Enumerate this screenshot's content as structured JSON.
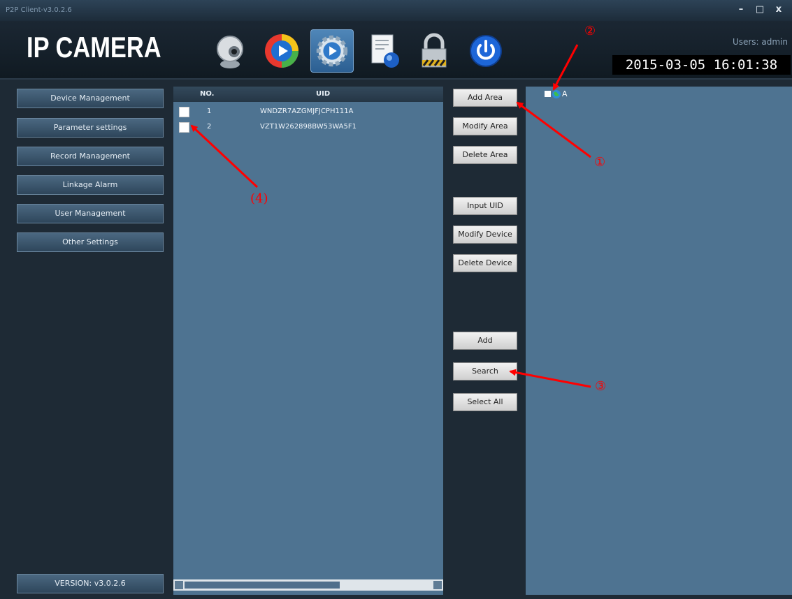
{
  "window": {
    "title": "P2P Client-v3.0.2.6",
    "controls": {
      "minimize": "–",
      "maximize": "□",
      "close": "x"
    }
  },
  "header": {
    "logo": "IP CAMERA",
    "toolbar_icons": [
      "webcam-icon",
      "playback-icon",
      "settings-icon",
      "document-icon",
      "lock-icon",
      "power-icon"
    ],
    "active_tool": "settings-icon",
    "users_label": "Users: admin",
    "datetime": "2015-03-05 16:01:38"
  },
  "sidebar": {
    "items": [
      {
        "label": "Device Management"
      },
      {
        "label": "Parameter settings"
      },
      {
        "label": "Record Management"
      },
      {
        "label": "Linkage Alarm"
      },
      {
        "label": "User Management"
      },
      {
        "label": "Other Settings"
      }
    ],
    "version": "VERSION: v3.0.2.6"
  },
  "device_list": {
    "columns": [
      "NO.",
      "UID"
    ],
    "rows": [
      {
        "no": "1",
        "uid": "WNDZR7AZGMJFJCPH111A",
        "checked": false
      },
      {
        "no": "2",
        "uid": "VZT1W262898BW53WA5F1",
        "checked": false
      }
    ]
  },
  "actions": {
    "add_area": "Add Area",
    "modify_area": "Modify Area",
    "delete_area": "Delete Area",
    "input_uid": "Input UID",
    "modify_device": "Modify Device",
    "delete_device": "Delete Device",
    "add": "Add",
    "search": "Search",
    "select_all": "Select All"
  },
  "area_tree": {
    "items": [
      {
        "label": "A",
        "checked": false
      }
    ]
  },
  "annotations": {
    "one": "①",
    "two": "②",
    "three": "③",
    "four": "(4)"
  },
  "colors": {
    "background": "#1e2a35",
    "panel": "#4e7391",
    "annotation": "#ff0000",
    "active_tool": "#3b73a8"
  }
}
